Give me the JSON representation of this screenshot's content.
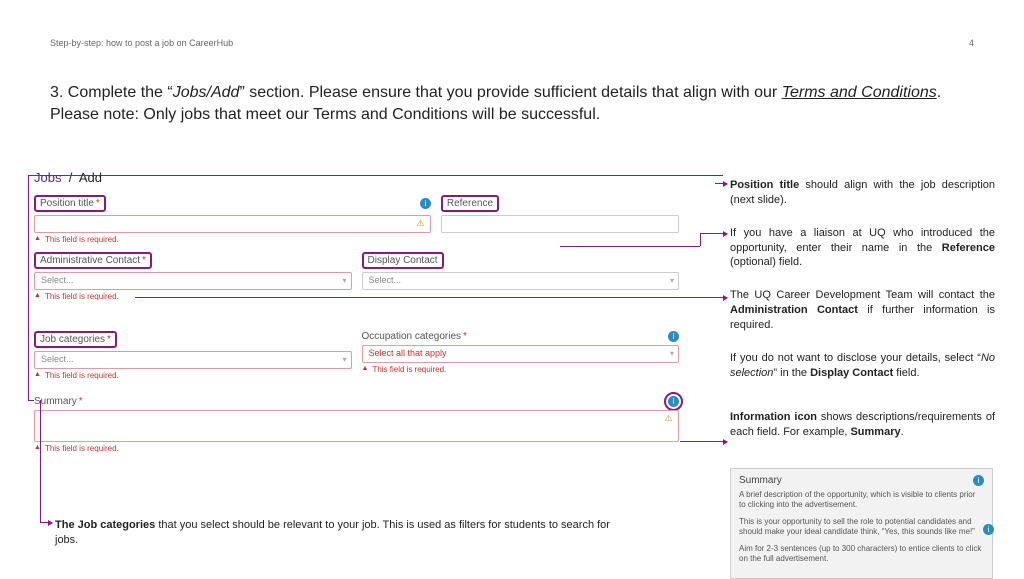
{
  "header": {
    "title": "Step-by-step: how to post a job on CareerHub",
    "page": "4"
  },
  "heading": {
    "prefix": "3. Complete the “",
    "section_name": "Jobs/Add",
    "mid": "” section. Please ensure that you provide sufficient details that align with our ",
    "terms": "Terms and Conditions",
    "suffix": ". Please note: Only jobs that meet our Terms and Conditions will be successful."
  },
  "breadcrumb": {
    "root": "Jobs",
    "sep": "/",
    "current": "Add"
  },
  "form": {
    "position": {
      "label": "Position title",
      "error": "This field is required."
    },
    "reference": {
      "label": "Reference"
    },
    "admin": {
      "label": "Administrative Contact",
      "placeholder": "Select...",
      "error": "This field is required."
    },
    "display": {
      "label": "Display Contact",
      "placeholder": "Select..."
    },
    "jobcat": {
      "label": "Job categories",
      "placeholder": "Select...",
      "error": "This field is required."
    },
    "occcat": {
      "label": "Occupation categories",
      "placeholder": "Select all that apply",
      "error": "This field is required."
    },
    "summary": {
      "label": "Summary",
      "error": "This field is required."
    }
  },
  "notes": {
    "n1a": "Position title",
    "n1b": " should align with the job description (next slide).",
    "n2a": "If you have a liaison at UQ who introduced the opportunity, enter their name in the ",
    "n2b": "Reference",
    "n2c": " (optional) field.",
    "n3a": "The UQ Career Development Team will contact the ",
    "n3b": "Administration Contact",
    "n3c": " if further information is required.",
    "n4a": "If you do not want to disclose your details, select “",
    "n4b": "No selection",
    "n4c": "” in the ",
    "n4d": "Display Contact",
    "n4e": " field.",
    "n5a": "Information icon",
    "n5b": " shows descriptions/requirements of each field. For example, ",
    "n5c": "Summary",
    "n5d": "."
  },
  "tooltip": {
    "title": "Summary",
    "p1": "A brief description of the opportunity, which is visible to clients prior to clicking into the advertisement.",
    "p2": "This is your opportunity to sell the role to potential candidates and should make your ideal candidate think, “Yes, this sounds like me!”",
    "p3": "Aim for 2-3 sentences (up to 300 characters) to entice clients to click on the full advertisement."
  },
  "bottom": {
    "b1": "The Job categories",
    "b2": " that you select should be relevant to your job. This is used as filters for students to search for jobs."
  },
  "glyph": {
    "info": "i",
    "warn": "⚠",
    "caret": "▾"
  }
}
